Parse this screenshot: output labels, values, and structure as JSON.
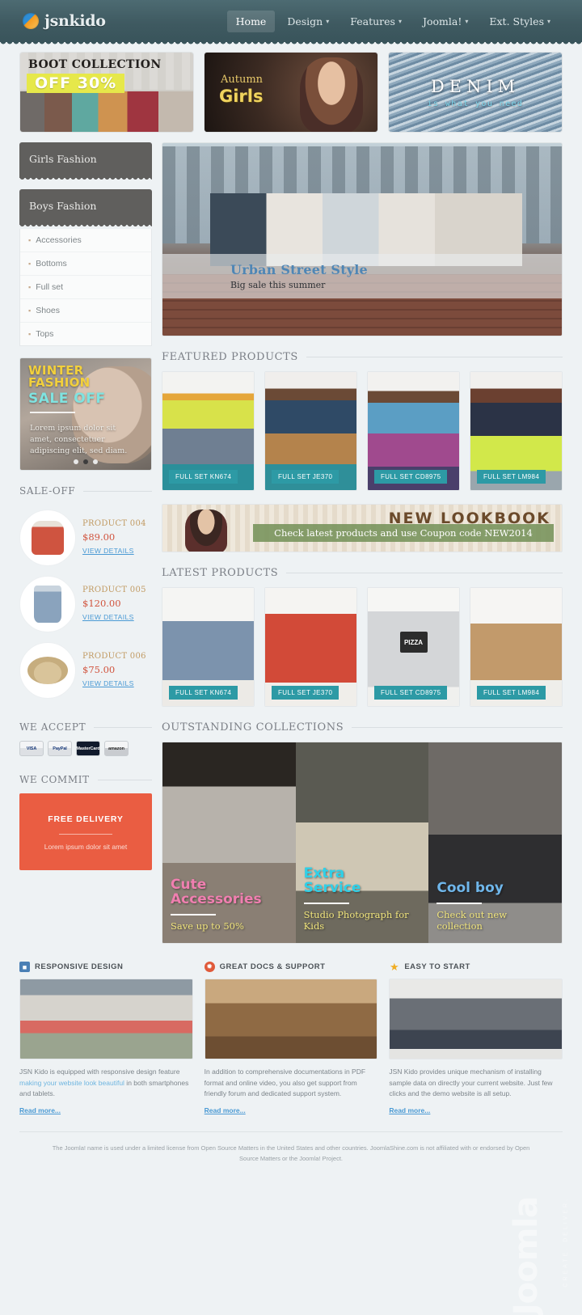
{
  "header": {
    "logo_text": "jsnkido",
    "nav": [
      {
        "label": "Home",
        "caret": "",
        "active": true
      },
      {
        "label": "Design",
        "caret": "▾",
        "active": false
      },
      {
        "label": "Features",
        "caret": "▾",
        "active": false
      },
      {
        "label": "Joomla!",
        "caret": "▾",
        "active": false
      },
      {
        "label": "Ext. Styles",
        "caret": "▾",
        "active": false
      }
    ]
  },
  "promos": [
    {
      "line1": "BOOT COLLECTION",
      "line2": "OFF 30%"
    },
    {
      "line1": "Autumn",
      "line2": "Girls"
    },
    {
      "line1": "DENIM",
      "line2": "is what you need"
    }
  ],
  "sidebar": {
    "menu_girls": "Girls Fashion",
    "menu_boys": "Boys Fashion",
    "boys_items": [
      {
        "label": "Accessories"
      },
      {
        "label": "Bottoms"
      },
      {
        "label": "Full set"
      },
      {
        "label": "Shoes"
      },
      {
        "label": "Tops"
      }
    ],
    "banner": {
      "line1": "WINTER\nFASHION",
      "line2": "SALE OFF",
      "paragraph": "Lorem ipsum dolor sit amet, consectetuer adipiscing elit, sed diam."
    },
    "saleoff_title": "SALE-OFF",
    "saleoff_items": [
      {
        "name": "PRODUCT 004",
        "price": "$89.00",
        "link": "VIEW DETAILS"
      },
      {
        "name": "PRODUCT 005",
        "price": "$120.00",
        "link": "VIEW DETAILS"
      },
      {
        "name": "PRODUCT 006",
        "price": "$75.00",
        "link": "VIEW DETAILS"
      }
    ],
    "accept_title": "WE ACCEPT",
    "payments": [
      {
        "label": "VISA"
      },
      {
        "label": "PayPal"
      },
      {
        "label": "MasterCard"
      },
      {
        "label": "amazon"
      }
    ],
    "commit_title": "WE COMMIT",
    "commit_heading": "FREE DELIVERY",
    "commit_text": "Lorem ipsum dolor sit amet"
  },
  "hero": {
    "heading": "Urban Street Style",
    "subheading": "Big sale this summer"
  },
  "featured": {
    "title": "FEATURED PRODUCTS",
    "items": [
      {
        "tag": "FULL SET KN674"
      },
      {
        "tag": "FULL SET JE370"
      },
      {
        "tag": "FULL SET CD8975"
      },
      {
        "tag": "FULL SET LM984"
      }
    ]
  },
  "lookbook": {
    "title": "NEW LOOKBOOK",
    "bar": "Check latest products and use Coupon code NEW2014"
  },
  "latest": {
    "title": "LATEST PRODUCTS",
    "items": [
      {
        "tag": "FULL SET KN674"
      },
      {
        "tag": "FULL SET JE370"
      },
      {
        "tag": "FULL SET CD8975",
        "graphic": "PIZZA"
      },
      {
        "tag": "FULL SET LM984"
      }
    ]
  },
  "collections": {
    "title": "OUTSTANDING COLLECTIONS",
    "items": [
      {
        "heading": "Cute\nAccessories",
        "sub": "Save up to 50%",
        "color": "#f07fb0"
      },
      {
        "heading": "Extra\nService",
        "sub": "Studio Photograph for Kids",
        "color": "#2fd0e8"
      },
      {
        "heading": "Cool boy",
        "sub": "Check out new collection",
        "color": "#6fb6ea"
      }
    ]
  },
  "features": [
    {
      "icon": "monitor-icon",
      "glyph": "■",
      "title": "RESPONSIVE DESIGN",
      "text_before": "JSN Kido is equipped with responsive design feature ",
      "text_link": "making your website look beautiful",
      "text_after": " in both smartphones and tablets.",
      "more": "Read more..."
    },
    {
      "icon": "lifebuoy-icon",
      "glyph": "✹",
      "title": "GREAT DOCS & SUPPORT",
      "text_before": "In addition to comprehensive documentations in PDF format and online video, you also get support from friendly forum and dedicated support system.",
      "text_link": "",
      "text_after": "",
      "more": "Read more..."
    },
    {
      "icon": "star-icon",
      "glyph": "★",
      "title": "EASY TO START",
      "text_before": "JSN Kido provides unique mechanism of installing sample data on directly your current website. Just few clicks and the demo website is all setup.",
      "text_link": "",
      "text_after": "",
      "more": "Read more..."
    }
  ],
  "watermark": {
    "text": "Joomla",
    "sub": "CREATE. DELIVER."
  },
  "footer": {
    "text": "The Joomla! name is used under a limited license from Open Source Matters in the United States and other countries. JoomlaShine.com is not affiliated with or endorsed by Open Source Matters or the Joomla! Project."
  },
  "colors": {
    "header_bg": "#3f5a61",
    "tag_teal": "#2d9aa5",
    "accent_orange": "#ea5d42",
    "link_blue": "#4a9ad4"
  }
}
